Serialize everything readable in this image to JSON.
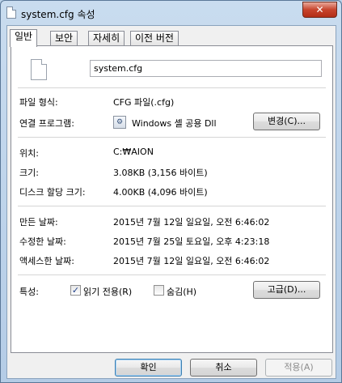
{
  "window": {
    "title": "system.cfg 속성",
    "close_symbol": "✕"
  },
  "tabs": [
    {
      "label": "일반",
      "active": true
    },
    {
      "label": "보안"
    },
    {
      "label": "자세히"
    },
    {
      "label": "이전 버전"
    }
  ],
  "general": {
    "file_name": "system.cfg",
    "file_type_label": "파일 형식:",
    "file_type_value": "CFG 파일(.cfg)",
    "opens_with_label": "연결 프로그램:",
    "opens_with_value": "Windows 셸 공용 Dll",
    "change_button": "변경(C)...",
    "location_label": "위치:",
    "location_value": "C:₩AION",
    "size_label": "크기:",
    "size_value": "3.08KB (3,156 바이트)",
    "size_on_disk_label": "디스크 할당 크기:",
    "size_on_disk_value": "4.00KB (4,096 바이트)",
    "created_label": "만든 날짜:",
    "created_value": "2015년 7월 12일 일요일, 오전 6:46:02",
    "modified_label": "수정한 날짜:",
    "modified_value": "2015년 7월 25일 토요일, 오후 4:23:18",
    "accessed_label": "액세스한 날짜:",
    "accessed_value": "2015년 7월 12일 일요일, 오전 6:46:02",
    "attributes_label": "특성:",
    "readonly_label": "읽기 전용(R)",
    "readonly_checked": true,
    "hidden_label": "숨김(H)",
    "hidden_checked": false,
    "advanced_button": "고급(D)..."
  },
  "footer": {
    "ok_button": "확인",
    "cancel_button": "취소",
    "apply_button": "적용(A)"
  }
}
